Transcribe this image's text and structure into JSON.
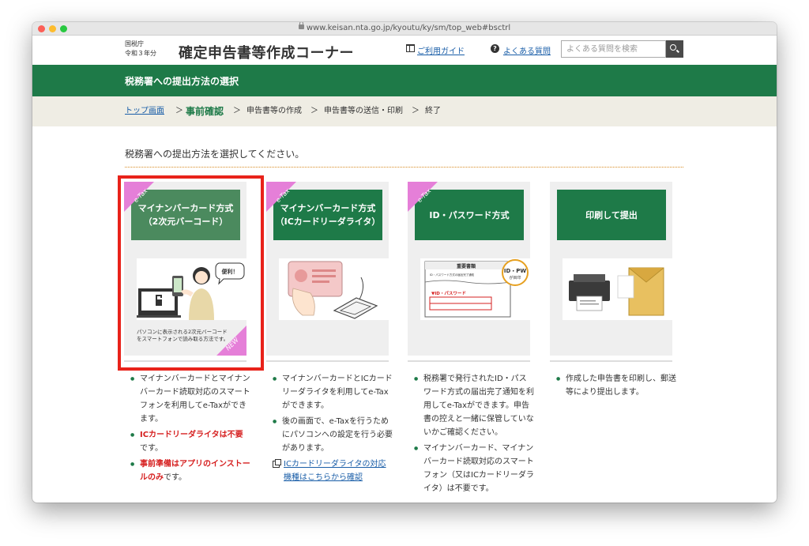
{
  "browser": {
    "url": "www.keisan.nta.go.jp/kyoutu/ky/sm/top_web#bsctrl"
  },
  "header": {
    "org_line1": "国税庁",
    "org_line2": "令和３年分",
    "title": "確定申告書等作成コーナー",
    "guide_link": "ご利用ガイド",
    "faq_link": "よくある質問",
    "search_placeholder": "よくある質問を検索"
  },
  "band": {
    "title": "税務署への提出方法の選択"
  },
  "breadcrumb": {
    "top": "トップ画面",
    "current": "事前確認",
    "step3": "申告書等の作成",
    "step4": "申告書等の送信・印刷",
    "step5": "終了",
    "sep": "＞"
  },
  "instruction": "税務署への提出方法を選択してください。",
  "cards": [
    {
      "ribbon": "e-Tax",
      "title_line1": "マイナンバーカード方式",
      "title_line2": "（2次元バーコード）",
      "caption_line1": "パソコンに表示される2次元バーコード",
      "caption_line2": "をスマートフォンで読み取る方法です。",
      "new_badge": "NEW",
      "illustration_bubble": "便利！"
    },
    {
      "ribbon": "e-Tax",
      "title_line1": "マイナンバーカード方式",
      "title_line2": "（ICカードリーダライタ）"
    },
    {
      "ribbon": "e-Tax",
      "title_line1": "ID・パスワード方式",
      "doc_title": "重要書類",
      "doc_sub": "ID・パスワード方式の届出完了通知",
      "badge_top": "ID・PW",
      "badge_bottom": "が目印",
      "pw_label": "▼ID・パスワード"
    },
    {
      "title_line1": "印刷して提出"
    }
  ],
  "columns": [
    {
      "b1": "マイナンバーカードとマイナンバーカード読取対応のスマートフォンを利用してe-Taxができます。",
      "b2_red": "ICカードリーダライタは不要",
      "b2_rest": "です。",
      "b3_red": "事前準備はアプリのインストールのみ",
      "b3_rest": "です。"
    },
    {
      "b1": "マイナンバーカードとICカードリーダライタを利用してe-Taxができます。",
      "b2": "後の画面で、e-Taxを行うためにパソコンへの設定を行う必要があります。",
      "link": "ICカードリーダライタの対応機種はこちらから確認"
    },
    {
      "b1": "税務署で発行されたID・パスワード方式の届出完了通知を利用してe-Taxができます。申告書の控えと一緒に保管していないかご確認ください。",
      "b2": "マイナンバーカード、マイナンバーカード読取対応のスマートフォン（又はICカードリーダライタ）は不要です。"
    },
    {
      "b1": "作成した申告書を印刷し、郵送等により提出します。"
    }
  ],
  "colors": {
    "brand_green": "#1e7a48",
    "ribbon_pink": "#e57fd8",
    "highlight_red": "#e8221a"
  }
}
